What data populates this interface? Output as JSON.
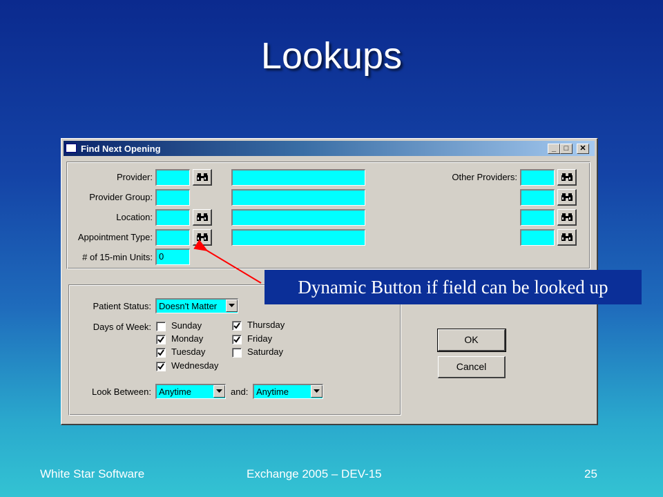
{
  "slide": {
    "title": "Lookups",
    "footer_left": "White Star Software",
    "footer_center": "Exchange 2005 – DEV-15",
    "footer_right": "25"
  },
  "window": {
    "title": "Find Next Opening",
    "controls": {
      "minimize": "_",
      "maximize": "□",
      "close": "✕"
    }
  },
  "form": {
    "provider_label": "Provider:",
    "provider_group_label": "Provider Group:",
    "location_label": "Location:",
    "appointment_type_label": "Appointment Type:",
    "units_label": "# of 15-min Units:",
    "units_value": "0",
    "other_providers_label": "Other Providers:",
    "patient_status_label": "Patient Status:",
    "patient_status_value": "Doesn't Matter",
    "days_of_week_label": "Days of Week:",
    "days": [
      {
        "label": "Sunday",
        "checked": false
      },
      {
        "label": "Monday",
        "checked": true
      },
      {
        "label": "Tuesday",
        "checked": true
      },
      {
        "label": "Wednesday",
        "checked": true
      },
      {
        "label": "Thursday",
        "checked": true
      },
      {
        "label": "Friday",
        "checked": true
      },
      {
        "label": "Saturday",
        "checked": false
      }
    ],
    "look_between_label": "Look Between:",
    "look_between_from": "Anytime",
    "and_label": "and:",
    "look_between_to": "Anytime",
    "ok_label": "OK",
    "cancel_label": "Cancel"
  },
  "callout": {
    "text": "Dynamic  Button if field can be looked up",
    "arrow_color": "#ff0000"
  },
  "icons": {
    "lookup": "binoculars-icon",
    "dropdown": "chevron-down-icon",
    "check": "checkmark-icon"
  },
  "colors": {
    "field": "#00ffff",
    "window_face": "#d4d0c8",
    "titlebar_start": "#0a246a",
    "callout_bg": "#0b2f98"
  }
}
